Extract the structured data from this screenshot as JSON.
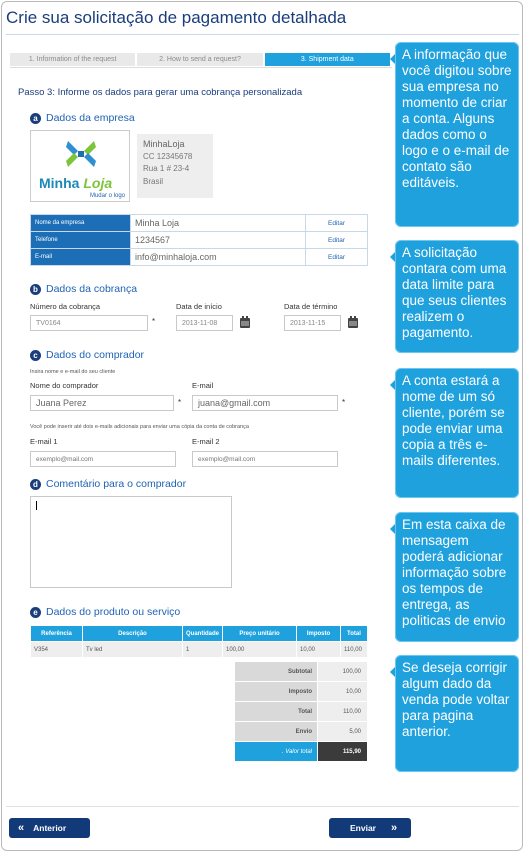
{
  "title": "Crie sua solicitação de pagamento detalhada",
  "steps": [
    "1. Information of the request",
    "2. How to send a request?",
    "3. Shipment data"
  ],
  "active_step": 3,
  "step_title": "Passo 3: Informe os dados para gerar uma cobrança personalizada",
  "sections": {
    "a": {
      "badge": "a",
      "title": "Dados da empresa"
    },
    "b": {
      "badge": "b",
      "title": "Dados da cobrança"
    },
    "c": {
      "badge": "c",
      "title": "Dados do comprador"
    },
    "d": {
      "badge": "d",
      "title": "Comentário para o comprador"
    },
    "e": {
      "badge": "e",
      "title": "Dados do produto ou serviço"
    }
  },
  "logo": {
    "word1": "Minha",
    "word2": "Loja",
    "change_link": "Mudar o logo"
  },
  "company_card": {
    "name": "MinhaLoja",
    "cc": "CC 12345678",
    "address": "Rua 1 # 23-4",
    "country": "Brasil"
  },
  "company_rows": [
    {
      "label": "Nome da empresa",
      "value": "Minha Loja",
      "action": "Editar"
    },
    {
      "label": "Telefone",
      "value": "1234567",
      "action": "Editar"
    },
    {
      "label": "E-mail",
      "value": "info@minhaloja.com",
      "action": "Editar"
    }
  ],
  "billing": {
    "number_label": "Número da cobrança",
    "number_value": "TV0164",
    "start_label": "Data de início",
    "start_value": "2013-11-08",
    "end_label": "Data de término",
    "end_value": "2013-11-15",
    "required_mark": "*"
  },
  "buyer": {
    "hint": "Insira nome e e-mail do seu cliente",
    "name_label": "Nome do comprador",
    "name_value": "Juana Perez",
    "email_label": "E-mail",
    "email_value": "juana@gmail.com",
    "extra_hint": "Você pode inserir até dois e-mails adicionais para enviar uma cópia da conta de cobrança",
    "email1_label": "E-mail 1",
    "email1_placeholder": "exemplo@mail.com",
    "email2_label": "E-mail 2",
    "email2_placeholder": "exemplo@mail.com"
  },
  "products": {
    "headers": [
      "Referência",
      "Descrição",
      "Quantidade",
      "Preço unitário",
      "Imposto",
      "Total"
    ],
    "rows": [
      [
        "V354",
        "Tv led",
        "1",
        "100,00",
        "10,00",
        "110,00"
      ]
    ]
  },
  "totals": [
    {
      "label": "Subtotal",
      "value": "100,00"
    },
    {
      "label": "Imposto",
      "value": "10,00"
    },
    {
      "label": "Total",
      "value": "110,00"
    },
    {
      "label": "Envio",
      "value": "5,00"
    },
    {
      "label": ". Valor total",
      "value": "115,90"
    }
  ],
  "buttons": {
    "back": "Anterior",
    "back_icon": "«",
    "send": "Enviar",
    "send_icon": "»"
  },
  "notes": [
    "A informação que você digitou sobre sua empresa no momento de criar a conta. Alguns dados como o logo e o e-mail de contato são editáveis.",
    "A solicitação contara com uma data limite para que seus clientes realizem o pagamento.",
    "A conta estará a nome de um só cliente, porém se pode enviar uma copia a três e-mails diferentes.",
    "Em esta caixa de mensagem poderá adicionar informação sobre os tempos de entrega, as politicas de envio",
    "Se deseja corrigir algum dado da venda pode voltar para pagina anterior."
  ],
  "colors": {
    "accent": "#1fa1dd",
    "navy": "#1a3d7c",
    "button": "#123a78"
  }
}
